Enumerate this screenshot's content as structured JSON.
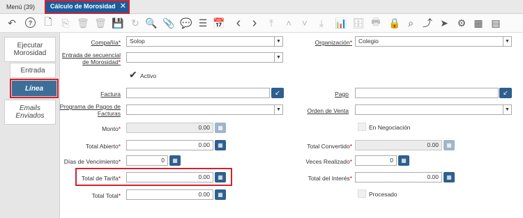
{
  "tabs": {
    "menu": "Menú (39)",
    "active": "Cálculo de Morosidad"
  },
  "sidebar": {
    "items": [
      {
        "label1": "Ejecutar",
        "label2": "Morosidad"
      },
      {
        "label1": "Entrada",
        "label2": ""
      },
      {
        "label1": "Línea",
        "label2": ""
      },
      {
        "label1": "Emails",
        "label2": "Enviados"
      }
    ]
  },
  "form": {
    "compania": {
      "label": "Compañía",
      "value": "Solop"
    },
    "organizacion": {
      "label": "Organización",
      "value": "Colegio"
    },
    "entrada": {
      "label1": "Entrada de secuencial",
      "label2": "de Morosidad",
      "value": ""
    },
    "activo": {
      "label": "Activo"
    },
    "factura": {
      "label": "Factura",
      "value": ""
    },
    "pago": {
      "label": "Pago",
      "value": ""
    },
    "programa": {
      "label1": "Programa de Pagos de",
      "label2": "Facturas",
      "value": ""
    },
    "orden": {
      "label": "Orden de Venta",
      "value": ""
    },
    "monto": {
      "label": "Monto",
      "value": "0.00"
    },
    "negociacion": {
      "label": "En Negociación"
    },
    "total_abierto": {
      "label": "Total Abierto",
      "value": "0.00"
    },
    "total_convertido": {
      "label": "Total Convertido",
      "value": "0.00"
    },
    "dias": {
      "label": "Días de Vencimiento",
      "value": "0"
    },
    "veces": {
      "label": "Veces Realizado",
      "value": "0"
    },
    "tarifa": {
      "label": "Total de Tarifa",
      "value": "0.00"
    },
    "interes": {
      "label": "Total del Interés",
      "value": "0.00"
    },
    "procesado": {
      "label": "Procesado"
    },
    "total_total": {
      "label": "Total Total",
      "value": "0.00"
    }
  },
  "required_mark": "*",
  "close_glyph": "✕",
  "icons": {
    "undo": "↶",
    "help": "?",
    "new": "🗋",
    "copy": "⎘",
    "delete": "🗑",
    "delete2": "🗑",
    "save": "💾",
    "refresh": "↻",
    "find": "🔍",
    "attach": "📎",
    "chat": "💬",
    "grid": "☰",
    "calendar": "📅",
    "prev": "‹",
    "next": "›",
    "first": "⤒",
    "up": "˄",
    "down": "˅",
    "last": "⤓",
    "report": "📊",
    "archive": "🗄",
    "print": "🖶",
    "lock": "🔒",
    "zoom": "⌕",
    "trend": "⤴",
    "workflow": "⚲",
    "send": "➤",
    "gear": "⚙",
    "product": "▦",
    "form": "▤",
    "calc": "▦",
    "search": "↙"
  }
}
